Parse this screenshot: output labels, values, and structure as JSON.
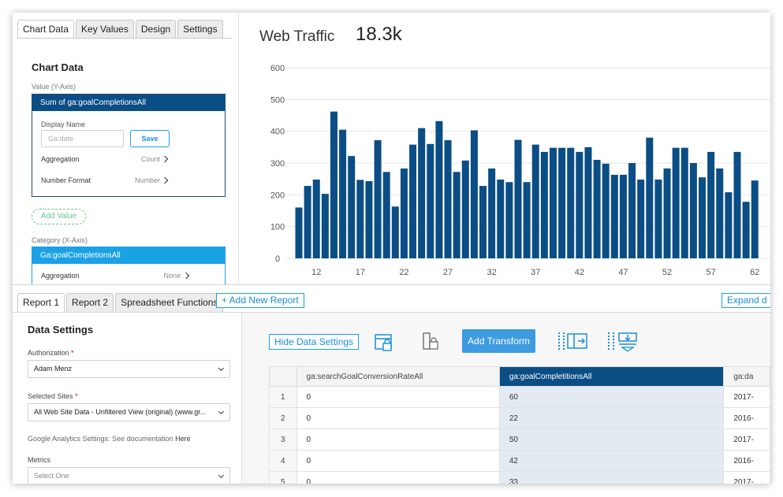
{
  "chart_panel": {
    "tabs": [
      "Chart Data",
      "Key Values",
      "Design",
      "Settings"
    ],
    "title": "Chart Data",
    "value_axis_label": "Value (Y-Axis)",
    "value_card": {
      "header": "Sum of ga:goalCompletionsAll",
      "display_name_label": "Display Name",
      "display_name_placeholder": "Ga:date",
      "save_label": "Save",
      "aggregation_label": "Aggregation",
      "aggregation_value": "Count",
      "number_format_label": "Number Format",
      "number_format_value": "Number"
    },
    "add_value_label": "Add Value",
    "category_axis_label": "Category (X-Axis)",
    "category_card": {
      "header": "Ga:goalCompletionsAll",
      "aggregation_label": "Aggregation",
      "aggregation_value": "None"
    }
  },
  "chart": {
    "title": "Web Traffic",
    "total": "18.3k"
  },
  "chart_data": {
    "type": "bar",
    "title": "Web Traffic",
    "color": "#0b4d85",
    "ylim": [
      0,
      600
    ],
    "yticks": [
      0,
      100,
      200,
      300,
      400,
      500,
      600
    ],
    "xtick_labels": [
      "12",
      "17",
      "22",
      "27",
      "32",
      "37",
      "42",
      "47",
      "52",
      "57",
      "62"
    ],
    "grid": true,
    "x": [
      10,
      11,
      12,
      13,
      14,
      15,
      16,
      17,
      18,
      19,
      20,
      21,
      22,
      23,
      24,
      25,
      26,
      27,
      28,
      29,
      30,
      31,
      32,
      33,
      34,
      35,
      36,
      37,
      38,
      39,
      40,
      41,
      42,
      43,
      44,
      45,
      46,
      47,
      48,
      49,
      50,
      51,
      52,
      53,
      54,
      55,
      56,
      57,
      58,
      59,
      60,
      61,
      62,
      63,
      64,
      65,
      66
    ],
    "values": [
      160,
      228,
      248,
      203,
      462,
      405,
      322,
      247,
      243,
      372,
      272,
      163,
      283,
      358,
      410,
      360,
      432,
      372,
      272,
      308,
      403,
      228,
      283,
      248,
      240,
      373,
      240,
      358,
      335,
      348,
      348,
      348,
      335,
      350,
      310,
      298,
      263,
      263,
      300,
      248,
      380,
      248,
      283,
      348,
      348,
      300,
      255,
      335,
      283,
      208,
      335,
      178,
      245
    ]
  },
  "bottom": {
    "report_tabs": [
      "Report 1",
      "Report 2",
      "Spreadsheet Functions"
    ],
    "add_report_label": "+ Add New Report",
    "expand_label": "Expand d",
    "settings": {
      "title": "Data Settings",
      "authorization_label": "Authorization",
      "authorization_value": "Adam Menz",
      "sites_label": "Selected Sites",
      "sites_value": "All Web Site Data - Unfiltered View (original) (www.gr...",
      "ga_settings_text": "Google Analytics Settings: See documentation",
      "ga_settings_link": "Here",
      "metrics_label": "Metrics",
      "metrics_placeholder": "Select One",
      "required_mark": "*"
    },
    "toolbar": {
      "hide_label": "Hide Data Settings",
      "add_transform_label": "Add Transform"
    },
    "table": {
      "columns": [
        "",
        "ga:searchGoalConversionRateAll",
        "ga:goalCompletitionsAll",
        "ga:da"
      ],
      "rows": [
        [
          "1",
          "0",
          "60",
          "2017-"
        ],
        [
          "2",
          "0",
          "22",
          "2016-"
        ],
        [
          "3",
          "0",
          "50",
          "2017-"
        ],
        [
          "4",
          "0",
          "42",
          "2016-"
        ],
        [
          "5",
          "0",
          "33",
          "2017-"
        ]
      ]
    }
  }
}
